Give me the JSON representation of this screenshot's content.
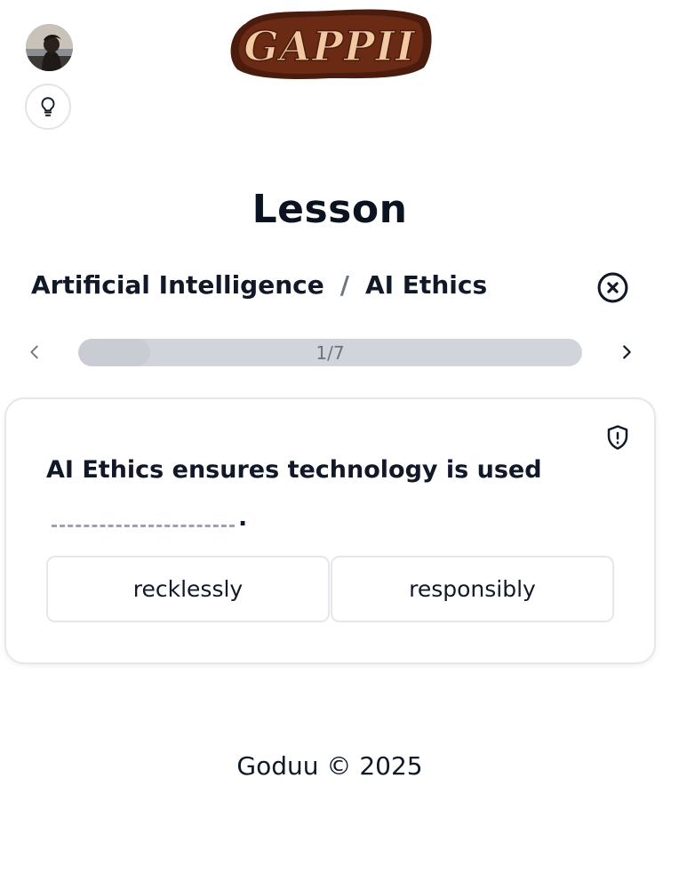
{
  "header": {
    "logo_text": "GAPPII",
    "avatar_alt": "user-avatar",
    "hint_icon": "lightbulb-icon"
  },
  "lesson": {
    "title": "Lesson",
    "breadcrumb": {
      "course": "Artificial Intelligence",
      "separator": "/",
      "topic": "AI Ethics"
    },
    "close_icon": "close-circle-icon",
    "progress": {
      "current": 1,
      "total": 7,
      "label": "1/7"
    }
  },
  "question": {
    "text": "AI Ethics ensures technology is used",
    "end_punct": ".",
    "report_icon": "shield-alert-icon",
    "options": [
      {
        "label": "recklessly"
      },
      {
        "label": "responsibly"
      }
    ]
  },
  "footer": {
    "text": "Goduu © 2025"
  },
  "colors": {
    "text_primary": "#111827",
    "muted": "#6b7280",
    "border": "#e5e7eb",
    "progress_track": "#d1d5db",
    "logo_fill": "#f3c9a3",
    "logo_outline": "#4a1c0e"
  }
}
